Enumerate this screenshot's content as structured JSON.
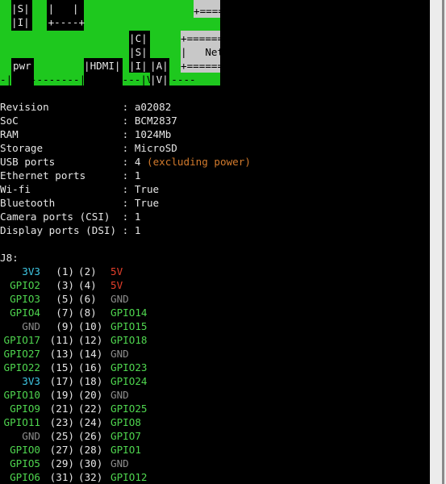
{
  "board": {
    "top_left": "|S|\n|I|",
    "top_mid": " |   |\n +----+",
    "top_right": "+====",
    "csi_box": "|C|\n|S|\n|I|",
    "a_box": "|A|\n|V|",
    "pwr": "pwr",
    "hdmi": "|HDMI|",
    "net": "+=======\n|   Net\n+======",
    "bottom_line": "-| |---------|    |----|V|------"
  },
  "info": [
    {
      "key": "Revision           ",
      "value": "a02082"
    },
    {
      "key": "SoC                ",
      "value": "BCM2837"
    },
    {
      "key": "RAM                ",
      "value": "1024Mb"
    },
    {
      "key": "Storage            ",
      "value": "MicroSD"
    },
    {
      "key": "USB ports          ",
      "value": "4",
      "note": "(excluding power)"
    },
    {
      "key": "Ethernet ports     ",
      "value": "1"
    },
    {
      "key": "Wi-fi              ",
      "value": "True"
    },
    {
      "key": "Bluetooth          ",
      "value": "True"
    },
    {
      "key": "Camera ports (CSI) ",
      "value": "1"
    },
    {
      "key": "Display ports (DSI)",
      "value": "1"
    }
  ],
  "header": "J8:",
  "pins": [
    {
      "l": "3V3",
      "lc": "cy",
      "a": "(1)",
      "b": "(2)",
      "r": "5V",
      "rc": "rd"
    },
    {
      "l": "GPIO2",
      "lc": "gn",
      "a": "(3)",
      "b": "(4)",
      "r": "5V",
      "rc": "rd"
    },
    {
      "l": "GPIO3",
      "lc": "gn",
      "a": "(5)",
      "b": "(6)",
      "r": "GND",
      "rc": "gy"
    },
    {
      "l": "GPIO4",
      "lc": "gn",
      "a": "(7)",
      "b": "(8)",
      "r": "GPIO14",
      "rc": "gn"
    },
    {
      "l": "GND",
      "lc": "gy",
      "a": "(9)",
      "b": "(10)",
      "r": "GPIO15",
      "rc": "gn"
    },
    {
      "l": "GPIO17",
      "lc": "gn",
      "a": "(11)",
      "b": "(12)",
      "r": "GPIO18",
      "rc": "gn"
    },
    {
      "l": "GPIO27",
      "lc": "gn",
      "a": "(13)",
      "b": "(14)",
      "r": "GND",
      "rc": "gy"
    },
    {
      "l": "GPIO22",
      "lc": "gn",
      "a": "(15)",
      "b": "(16)",
      "r": "GPIO23",
      "rc": "gn"
    },
    {
      "l": "3V3",
      "lc": "cy",
      "a": "(17)",
      "b": "(18)",
      "r": "GPIO24",
      "rc": "gn"
    },
    {
      "l": "GPIO10",
      "lc": "gn",
      "a": "(19)",
      "b": "(20)",
      "r": "GND",
      "rc": "gy"
    },
    {
      "l": "GPIO9",
      "lc": "gn",
      "a": "(21)",
      "b": "(22)",
      "r": "GPIO25",
      "rc": "gn"
    },
    {
      "l": "GPIO11",
      "lc": "gn",
      "a": "(23)",
      "b": "(24)",
      "r": "GPIO8",
      "rc": "gn"
    },
    {
      "l": "GND",
      "lc": "gy",
      "a": "(25)",
      "b": "(26)",
      "r": "GPIO7",
      "rc": "gn"
    },
    {
      "l": "GPIO0",
      "lc": "gn",
      "a": "(27)",
      "b": "(28)",
      "r": "GPIO1",
      "rc": "gn"
    },
    {
      "l": "GPIO5",
      "lc": "gn",
      "a": "(29)",
      "b": "(30)",
      "r": "GND",
      "rc": "gy"
    },
    {
      "l": "GPIO6",
      "lc": "gn",
      "a": "(31)",
      "b": "(32)",
      "r": "GPIO12",
      "rc": "gn"
    }
  ],
  "colors": {
    "board_green": "#1ec81e",
    "power_red": "#e8402b",
    "gpio_green": "#4fd64f",
    "v33_cyan": "#3fc9e6",
    "ground_gray": "#8c8c8c",
    "note_orange": "#d27a2c"
  }
}
